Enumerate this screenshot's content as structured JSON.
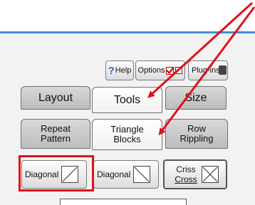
{
  "toolbar": {
    "help_label": "Help",
    "options_label": "Options",
    "plugins_label": "Plug-ins"
  },
  "tabs": [
    {
      "label": "Layout",
      "active": false
    },
    {
      "label": "Tools",
      "active": true
    },
    {
      "label": "Size",
      "active": false
    }
  ],
  "subtabs": [
    {
      "line1": "Repeat",
      "line2": "Pattern",
      "active": false
    },
    {
      "line1": "Triangle",
      "line2": "Blocks",
      "active": true
    },
    {
      "line1": "Row",
      "line2": "Rippling",
      "active": false
    }
  ],
  "tools": {
    "diagonal_1": "Diagonal",
    "diagonal_2": "Diagonal",
    "criss_line1": "Criss",
    "criss_line2": "Cross"
  },
  "colors": {
    "annotation_red": "#e0101c",
    "title_bar_blue": "#3f8fd8"
  }
}
